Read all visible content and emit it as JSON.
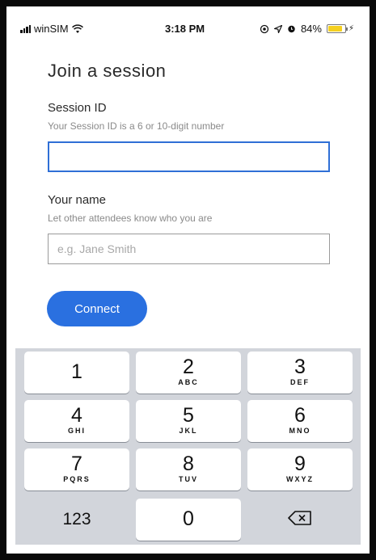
{
  "status_bar": {
    "carrier": "winSIM",
    "time": "3:18 PM",
    "battery_percent_text": "84%",
    "battery_level": 0.84,
    "icons": [
      "signal-icon",
      "wifi-icon",
      "location-lock-icon",
      "location-arrow-icon",
      "alarm-icon",
      "battery-icon",
      "charging-icon"
    ]
  },
  "form": {
    "title": "Join a session",
    "session_id": {
      "label": "Session ID",
      "hint": "Your Session ID is a 6 or 10-digit number",
      "value": "",
      "placeholder": ""
    },
    "name": {
      "label": "Your name",
      "hint": "Let other attendees know who you are",
      "value": "",
      "placeholder": "e.g. Jane Smith"
    },
    "connect_label": "Connect"
  },
  "keypad": {
    "keys": [
      {
        "digit": "1",
        "letters": ""
      },
      {
        "digit": "2",
        "letters": "ABC"
      },
      {
        "digit": "3",
        "letters": "DEF"
      },
      {
        "digit": "4",
        "letters": "GHI"
      },
      {
        "digit": "5",
        "letters": "JKL"
      },
      {
        "digit": "6",
        "letters": "MNO"
      },
      {
        "digit": "7",
        "letters": "PQRS"
      },
      {
        "digit": "8",
        "letters": "TUV"
      },
      {
        "digit": "9",
        "letters": "WXYZ"
      }
    ],
    "mode_label": "123",
    "zero": "0",
    "delete_icon": "delete-backspace-icon"
  },
  "colors": {
    "accent": "#2a70e0",
    "focus_border": "#2f6fd6",
    "keypad_bg": "#d2d5db",
    "battery_fill": "#f5d020"
  }
}
